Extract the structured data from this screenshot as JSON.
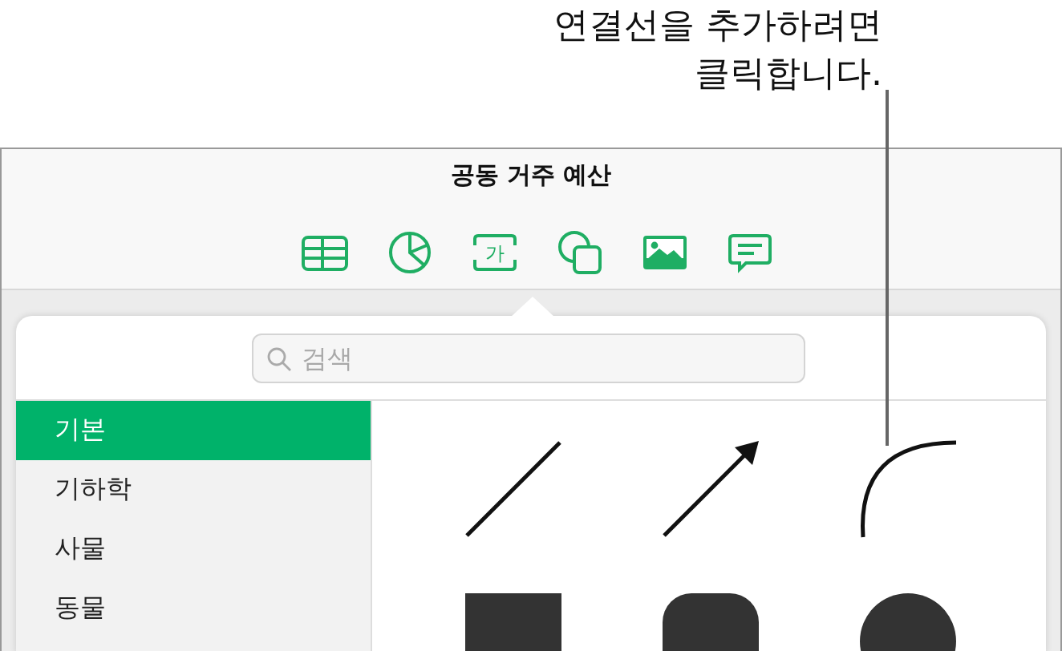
{
  "callout": {
    "lines": [
      "연결선을 추가하려면",
      "클릭합니다."
    ]
  },
  "window": {
    "title": "공동 거주 예산"
  },
  "toolbar": [
    {
      "kind": "table"
    },
    {
      "kind": "chart"
    },
    {
      "kind": "text",
      "label": "가"
    },
    {
      "kind": "shape"
    },
    {
      "kind": "media"
    },
    {
      "kind": "comment"
    }
  ],
  "popover": {
    "search": {
      "placeholder": "검색"
    },
    "categories": [
      {
        "label": "기본",
        "selected": true
      },
      {
        "label": "기하학",
        "selected": false
      },
      {
        "label": "사물",
        "selected": false
      },
      {
        "label": "동물",
        "selected": false
      }
    ],
    "shapes": [
      {
        "kind": "line"
      },
      {
        "kind": "arrow"
      },
      {
        "kind": "curve"
      },
      {
        "kind": "square"
      },
      {
        "kind": "rounded-square"
      },
      {
        "kind": "circle"
      }
    ]
  }
}
